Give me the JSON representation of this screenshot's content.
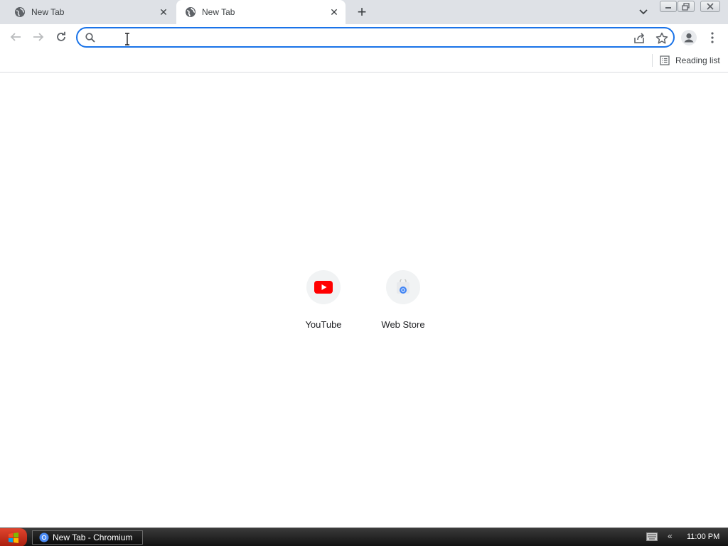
{
  "browser": {
    "tabs": [
      {
        "title": "New Tab",
        "active": false,
        "favicon": "globe-icon"
      },
      {
        "title": "New Tab",
        "active": true,
        "favicon": "globe-icon"
      }
    ],
    "new_tab_symbol": "+",
    "close_symbol": "✕"
  },
  "toolbar": {
    "omnibox_value": "",
    "omnibox_placeholder": "",
    "accent_color": "#1a73e8"
  },
  "bookmarks_bar": {
    "reading_list_label": "Reading list"
  },
  "shortcuts": [
    {
      "label": "YouTube",
      "icon": "youtube-icon"
    },
    {
      "label": "Web Store",
      "icon": "webstore-icon"
    }
  ],
  "taskbar": {
    "task_label": "New Tab - Chromium",
    "tray_chevron": "«",
    "clock": "11:00 PM"
  }
}
